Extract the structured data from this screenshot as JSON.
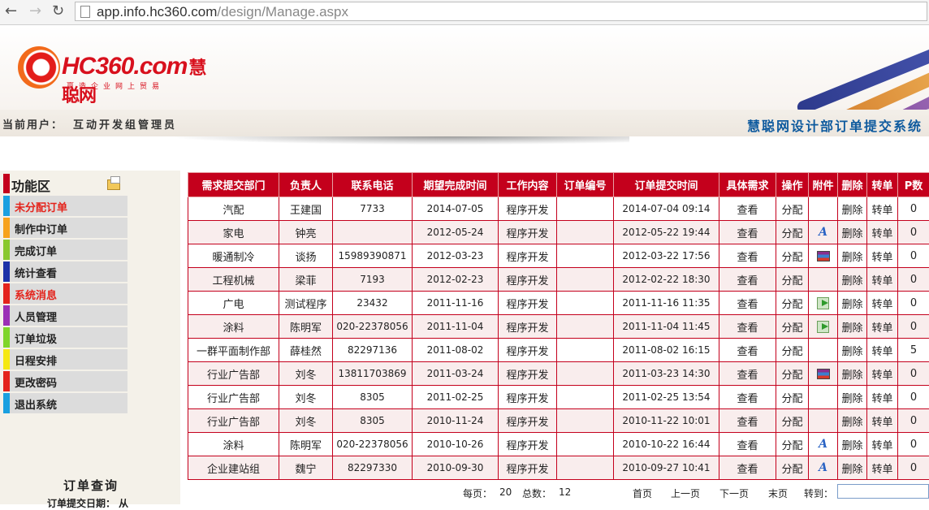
{
  "browser": {
    "url_host": "app.info.hc360.com",
    "url_path": "/design/Manage.aspx"
  },
  "header": {
    "logo_word": "HC360.com",
    "logo_cn": "慧聪网",
    "logo_tagline": "赢造企业网上贸易",
    "user_label": "当前用户：",
    "user_name": "互动开发组管理员",
    "system_title": "慧聪网设计部订单提交系统"
  },
  "sidebar": {
    "title": "功能区",
    "items": [
      {
        "label": "未分配订单",
        "color": "#1aa0e0",
        "active": true
      },
      {
        "label": "制作中订单",
        "color": "#f7a21b",
        "active": false
      },
      {
        "label": "完成订单",
        "color": "#8ac82d",
        "active": false
      },
      {
        "label": "统计查看",
        "color": "#1e32a8",
        "active": false
      },
      {
        "label": "系统消息",
        "color": "#e4231b",
        "active": true
      },
      {
        "label": "人员管理",
        "color": "#9b2fb5",
        "active": false
      },
      {
        "label": "订单垃圾",
        "color": "#7fd52a",
        "active": false
      },
      {
        "label": "日程安排",
        "color": "#f5e812",
        "active": false
      },
      {
        "label": "更改密码",
        "color": "#e4231b",
        "active": false
      },
      {
        "label": "退出系统",
        "color": "#1aa0e0",
        "active": false
      }
    ],
    "query_title": "订单查询",
    "query_sub": "订单提交日期： 从"
  },
  "table": {
    "headers": [
      "需求提交部门",
      "负责人",
      "联系电话",
      "期望完成时间",
      "工作内容",
      "订单编号",
      "订单提交时间",
      "具体需求",
      "操作",
      "附件",
      "删除",
      "转单",
      "P数"
    ],
    "rows": [
      [
        "汽配",
        "王建国",
        "7733",
        "2014-07-05",
        "程序开发",
        "",
        "2014-07-04 09:14",
        "查看",
        "分配",
        "",
        "删除",
        "转单",
        "0"
      ],
      [
        "家电",
        "钟亮",
        "",
        "2012-05-24",
        "程序开发",
        "",
        "2012-05-22 19:44",
        "查看",
        "分配",
        "A",
        "删除",
        "转单",
        "0"
      ],
      [
        "暖通制冷",
        "谈扬",
        "15989390871",
        "2012-03-23",
        "程序开发",
        "",
        "2012-03-22 17:56",
        "查看",
        "分配",
        "rar",
        "删除",
        "转单",
        "0"
      ],
      [
        "工程机械",
        "梁菲",
        "7193",
        "2012-02-23",
        "程序开发",
        "",
        "2012-02-22 18:30",
        "查看",
        "分配",
        "",
        "删除",
        "转单",
        "0"
      ],
      [
        "广电",
        "测试程序",
        "23432",
        "2011-11-16",
        "程序开发",
        "",
        "2011-11-16 11:35",
        "查看",
        "分配",
        "go",
        "删除",
        "转单",
        "0"
      ],
      [
        "涂料",
        "陈明军",
        "020-22378056",
        "2011-11-04",
        "程序开发",
        "",
        "2011-11-04 11:45",
        "查看",
        "分配",
        "go",
        "删除",
        "转单",
        "0"
      ],
      [
        "一群平面制作部",
        "薛桂然",
        "82297136",
        "2011-08-02",
        "程序开发",
        "",
        "2011-08-02 16:15",
        "查看",
        "分配",
        "",
        "删除",
        "转单",
        "5"
      ],
      [
        "行业广告部",
        "刘冬",
        "13811703869",
        "2011-03-24",
        "程序开发",
        "",
        "2011-03-23 14:30",
        "查看",
        "分配",
        "rar",
        "删除",
        "转单",
        "0"
      ],
      [
        "行业广告部",
        "刘冬",
        "8305",
        "2011-02-25",
        "程序开发",
        "",
        "2011-02-25 13:54",
        "查看",
        "分配",
        "",
        "删除",
        "转单",
        "0"
      ],
      [
        "行业广告部",
        "刘冬",
        "8305",
        "2010-11-24",
        "程序开发",
        "",
        "2010-11-22 10:01",
        "查看",
        "分配",
        "",
        "删除",
        "转单",
        "0"
      ],
      [
        "涂料",
        "陈明军",
        "020-22378056",
        "2010-10-26",
        "程序开发",
        "",
        "2010-10-22 16:44",
        "查看",
        "分配",
        "A",
        "删除",
        "转单",
        "0"
      ],
      [
        "企业建站组",
        "魏宁",
        "82297330",
        "2010-09-30",
        "程序开发",
        "",
        "2010-09-27 10:41",
        "查看",
        "分配",
        "A",
        "删除",
        "转单",
        "0"
      ]
    ]
  },
  "pager": {
    "per_page_label": "每页：",
    "per_page": "20",
    "total_label": "总数：",
    "total": "12",
    "first": "首页",
    "prev": "上一页",
    "next": "下一页",
    "last": "末页",
    "goto": "转到："
  }
}
